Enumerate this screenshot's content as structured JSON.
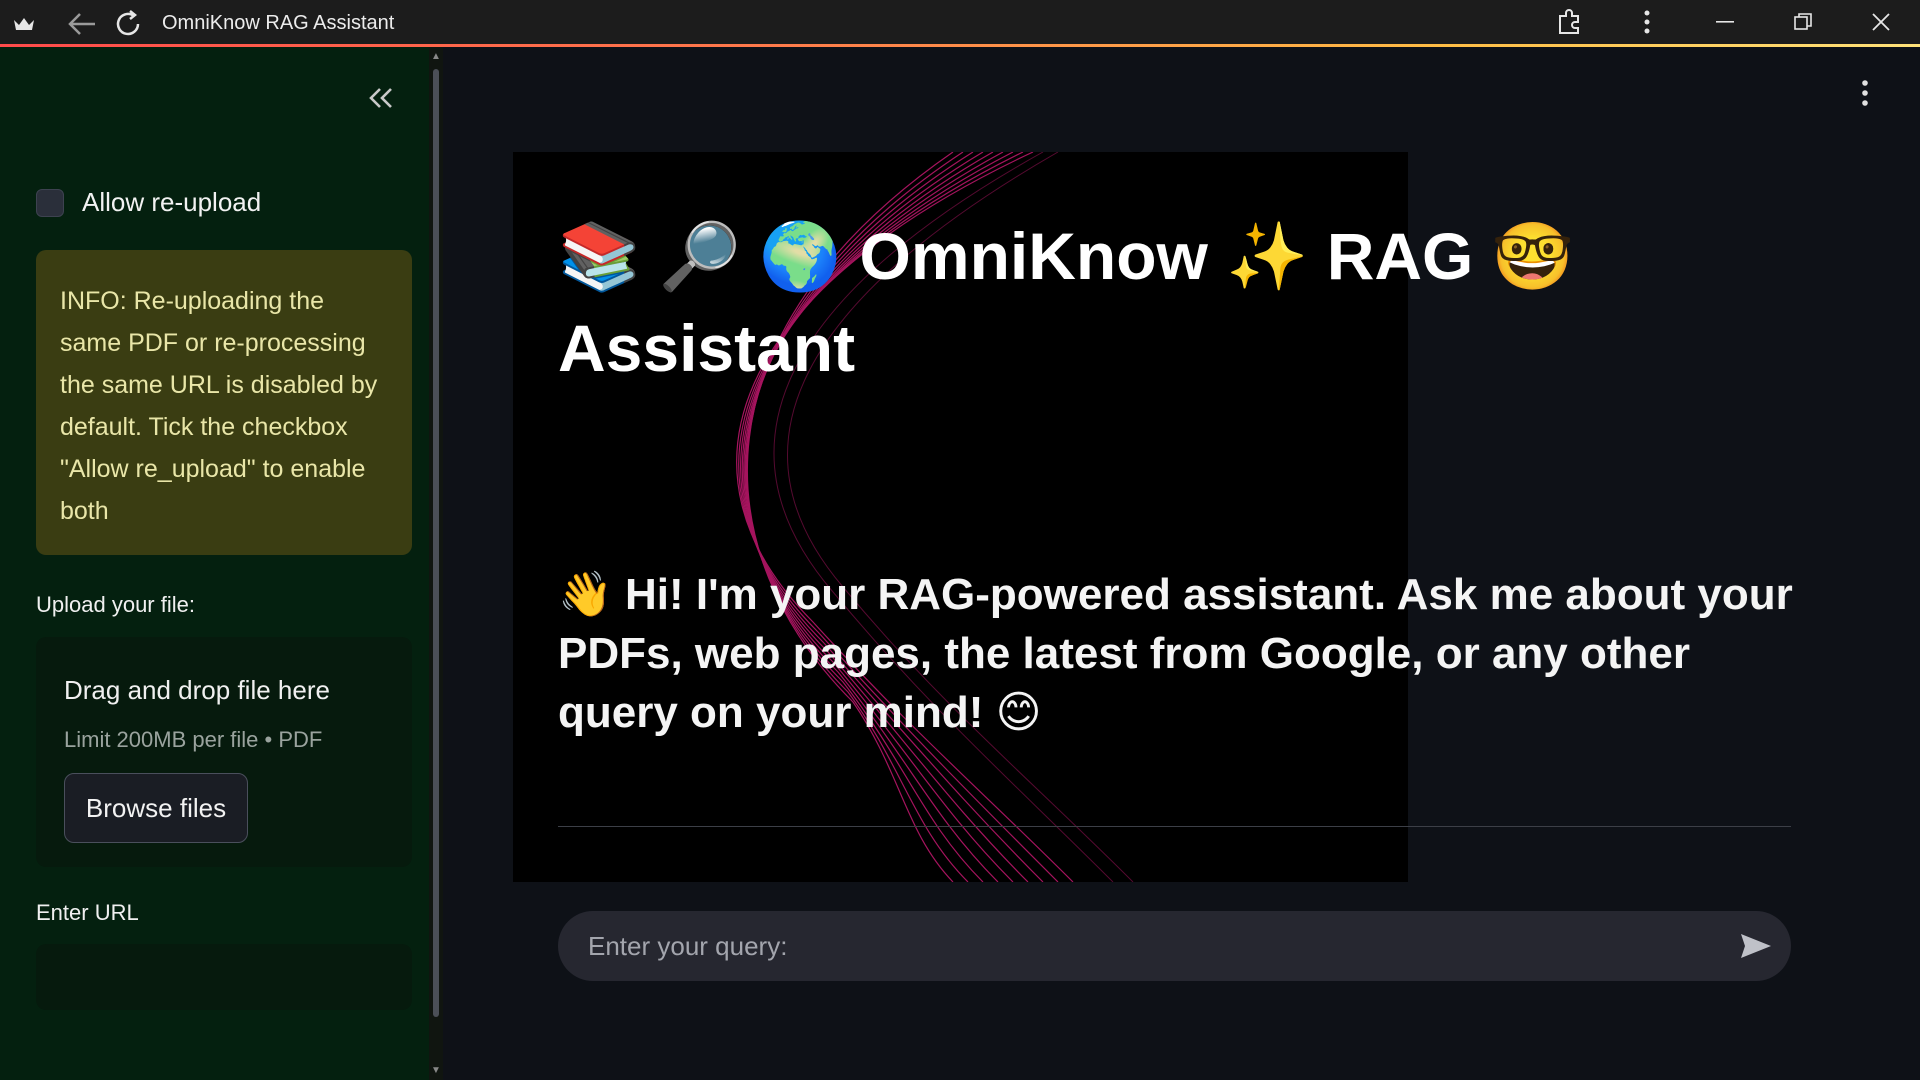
{
  "window": {
    "title": "OmniKnow RAG Assistant"
  },
  "sidebar": {
    "checkbox_label": "Allow re-upload",
    "info_text": "INFO: Re-uploading the same PDF or re-processing the same URL is disabled by default. Tick the checkbox \"Allow re_upload\" to enable both",
    "upload_label": "Upload your file:",
    "dropzone_title": "Drag and drop file here",
    "dropzone_limit": "Limit 200MB per file • PDF",
    "browse_label": "Browse files",
    "url_label": "Enter URL",
    "url_value": ""
  },
  "main": {
    "headline": "📚 🔎 🌍 OmniKnow ✨ RAG 🤓 Assistant",
    "greeting": "👋 Hi! I'm your RAG-powered assistant. Ask me about your PDFs, web pages, the latest from Google, or any other query on your mind! 😊",
    "query_placeholder": "Enter your query:"
  },
  "colors": {
    "sidebar_bg": "#04200f",
    "info_bg": "#3a3d12",
    "info_text": "#e9e6a8",
    "main_bg": "#0e1117",
    "accent_wave": "#c2186f"
  },
  "icons": {
    "app_logo": "crown-icon",
    "back": "arrow-left-icon",
    "reload": "refresh-icon",
    "extensions": "puzzle-icon",
    "menu": "kebab-menu-icon",
    "minimize": "minimize-icon",
    "restore": "restore-icon",
    "close": "close-icon",
    "collapse": "double-chevron-left-icon",
    "send": "send-icon"
  }
}
